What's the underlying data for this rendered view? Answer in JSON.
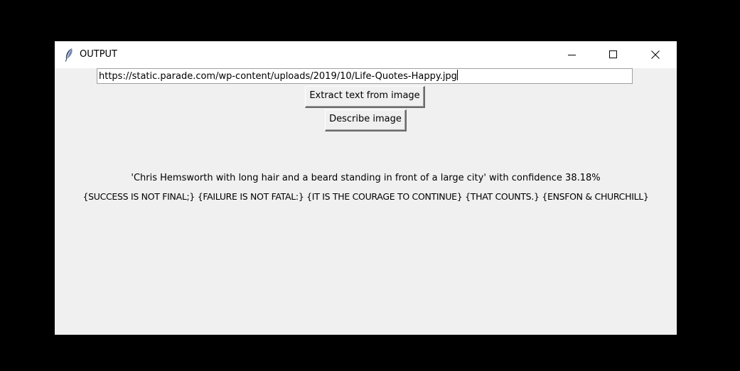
{
  "window": {
    "title": "OUTPUT"
  },
  "url_input": {
    "value": "https://static.parade.com/wp-content/uploads/2019/10/Life-Quotes-Happy.jpg"
  },
  "buttons": {
    "extract_label": "Extract text from image",
    "describe_label": "Describe image"
  },
  "results": {
    "caption": "'Chris Hemsworth with long hair and a beard standing in front of a large city' with confidence 38.18%",
    "ocr_text": "{SUCCESS IS NOT FINAL;} {FAILURE IS NOT FATAL:} {IT IS THE COURAGE TO CONTINUE} {THAT COUNTS.} {ENSFON & CHURCHILL}"
  },
  "icons": {
    "app": "feather-icon",
    "minimize": "minimize-icon",
    "maximize": "maximize-icon",
    "close": "close-icon"
  }
}
